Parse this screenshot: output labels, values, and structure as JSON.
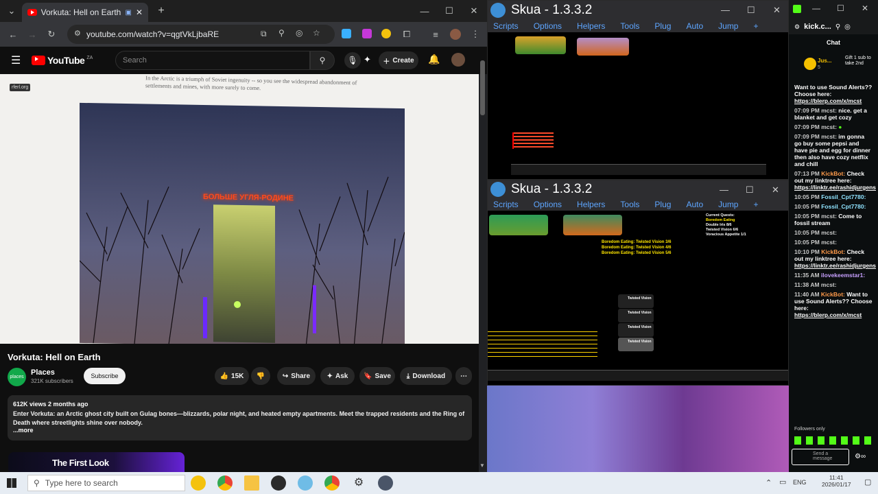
{
  "chrome": {
    "tab_title": "Vorkuta: Hell on Earth - You",
    "new_tab": "+",
    "url": "youtube.com/watch?v=qgtVkLjbaRE",
    "youtube": {
      "logo": "YouTube",
      "region": "ZA",
      "search_placeholder": "Search",
      "create_label": "Create",
      "video": {
        "watermark": "rferl.org",
        "article_text": "In the Arctic is a triumph of Soviet ingenuity -- so you see the widespread abandonment of settlements and mines, with more surely to come.",
        "sign_text": "БОЛЬШЕ УГЛЯ-РОДИНЕ"
      },
      "title": "Vorkuta: Hell on Earth",
      "channel": "Places",
      "subscribers": "321K subscribers",
      "subscribe_label": "Subscribe",
      "likes": "15K",
      "share_label": "Share",
      "ask_label": "Ask",
      "save_label": "Save",
      "download_label": "Download",
      "views": "612K views  2 months ago",
      "description": "Enter Vorkuta: an Arctic ghost city built on Gulag bones—blizzards, polar night, and heated empty apartments. Meet the trapped residents and the Ring of Death where streetlights shine over nobody.",
      "more": "...more",
      "next_thumb": "The First Look"
    }
  },
  "skua1": {
    "title": "Skua - 1.3.3.2",
    "menu": [
      "Scripts",
      "Options",
      "Helpers",
      "Tools",
      "Plug",
      "Auto",
      "Jump",
      "+"
    ]
  },
  "skua2": {
    "title": "Skua - 1.3.3.2",
    "menu": [
      "Scripts",
      "Options",
      "Helpers",
      "Tools",
      "Plug",
      "Auto",
      "Jump",
      "+"
    ],
    "quest_lines": [
      "Boredom Eating: Twisted Vision 3/6",
      "Boredom Eating: Twisted Vision 4/6",
      "Boredom Eating: Twisted Vision 5/6"
    ],
    "current_quests": "Current Quests:",
    "quest_list": [
      "Boredom Eating",
      "Double Iris 8/6",
      "Twisted Vision 6/6",
      "Voracious Appetite 1/1"
    ],
    "items": [
      "Twisted Vision",
      "Twisted Vision",
      "Twisted Vision",
      "Twisted Vision"
    ]
  },
  "kick": {
    "url": "kick.c...",
    "chat_header": "Chat",
    "gift_user": "Jus...",
    "gift_count": "5",
    "gift_text": "Gift 1 sub to take 2nd",
    "messages": [
      {
        "ts": "",
        "user": "",
        "text": "Want to use Sound Alerts?? Choose here:",
        "link": "https://blerp.com/x/mcst"
      },
      {
        "ts": "07:09 PM",
        "user": "mcst:",
        "text": "nice. get a blanket and get cozy",
        "link": ""
      },
      {
        "ts": "07:09 PM",
        "user": "mcst:",
        "text": "",
        "link": ""
      },
      {
        "ts": "07:09 PM",
        "user": "mcst:",
        "text": "im gonna go buy some pepsi and have pie and egg for dinner then also have cozy netflix and chill",
        "link": ""
      },
      {
        "ts": "07:13 PM",
        "user": "KickBot:",
        "text": "Check out my linktree here:",
        "link": "https://linktr.ee/rashidjurgens"
      },
      {
        "ts": "10:05 PM",
        "user": "Fossil_Cpt7780:",
        "text": "",
        "link": ""
      },
      {
        "ts": "10:05 PM",
        "user": "Fossil_Cpt7780:",
        "text": "",
        "link": ""
      },
      {
        "ts": "10:05 PM",
        "user": "mcst:",
        "text": "Come to fossil stream",
        "link": ""
      },
      {
        "ts": "10:05 PM",
        "user": "mcst:",
        "text": "",
        "link": ""
      },
      {
        "ts": "10:05 PM",
        "user": "mcst:",
        "text": "",
        "link": ""
      },
      {
        "ts": "10:10 PM",
        "user": "KickBot:",
        "text": "Check out my linktree here:",
        "link": "https://linktr.ee/rashidjurgens"
      },
      {
        "ts": "11:35 AM",
        "user": "ilovekeemstar1:",
        "text": "",
        "link": ""
      },
      {
        "ts": "11:38 AM",
        "user": "mcst:",
        "text": "",
        "link": ""
      },
      {
        "ts": "11:40 AM",
        "user": "KickBot:",
        "text": "Want to use Sound Alerts?? Choose here:",
        "link": "https://blerp.com/x/mcst"
      }
    ],
    "followers_only": "Followers only",
    "send_placeholder": "Send a message"
  },
  "taskbar": {
    "search_placeholder": "Type here to search",
    "lang": "ENG",
    "time": "11:41",
    "date": "2026/01/17"
  },
  "colors": {
    "youtube_red": "#ff0000",
    "skua_blue": "#5ea6ff",
    "kick_green": "#53fc18"
  }
}
